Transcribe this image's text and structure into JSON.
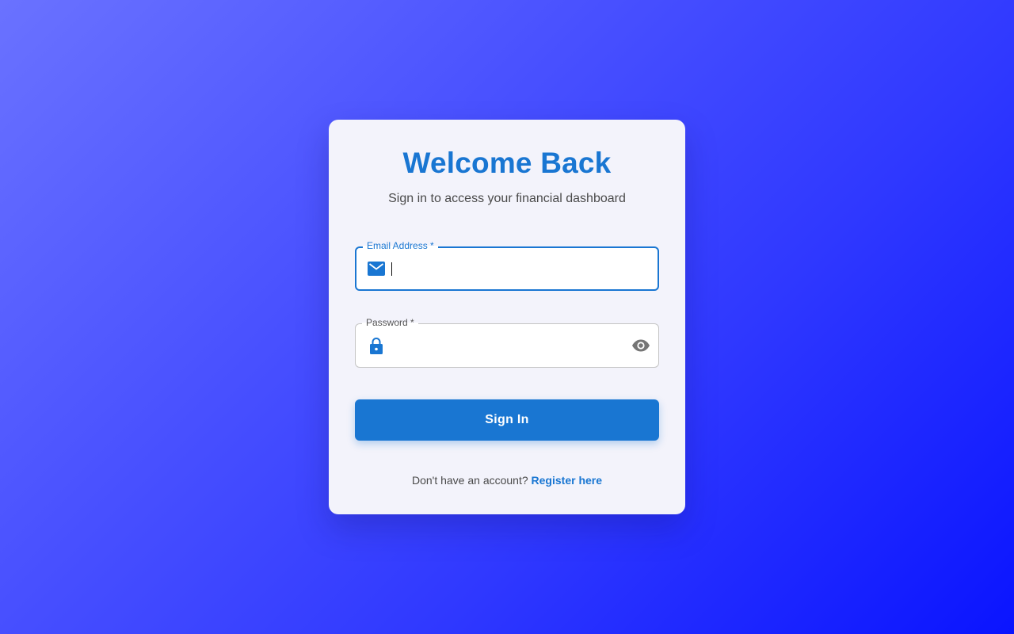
{
  "card": {
    "title": "Welcome Back",
    "subtitle": "Sign in to access your financial dashboard"
  },
  "email_field": {
    "label": "Email Address *",
    "value": "",
    "icon": "mail-icon",
    "focused": true
  },
  "password_field": {
    "label": "Password *",
    "value": "",
    "icon": "lock-icon",
    "toggle_icon": "eye-icon"
  },
  "signin_button": {
    "label": "Sign In"
  },
  "footer": {
    "prompt": "Don't have an account?",
    "link_label": "Register here"
  },
  "colors": {
    "accent": "#1976d2",
    "card_background": "#f3f3fb",
    "page_gradient_start": "#6a72ff",
    "page_gradient_end": "#0a14ff"
  }
}
